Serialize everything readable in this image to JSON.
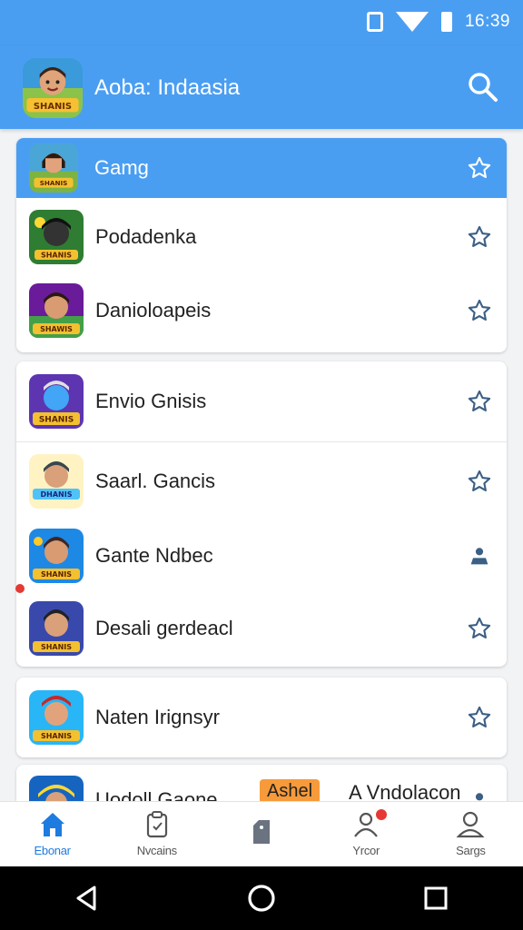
{
  "status_bar": {
    "time": "16:39",
    "icons": [
      "sim-icon",
      "wifi-icon",
      "battery-icon"
    ]
  },
  "app_bar": {
    "logo_text": "SHANIS",
    "title": "Aoba: Indaasia",
    "search_icon": "search-icon"
  },
  "colors": {
    "primary": "#4a9ef2",
    "active_nav": "#1e7be0",
    "accent_orange": "#f79a3a",
    "badge_red": "#e53935"
  },
  "cards": [
    {
      "items": [
        {
          "label": "Gamg",
          "selected": true,
          "thumb_text": "SHANIS"
        },
        {
          "label": "Podadenka",
          "selected": false,
          "thumb_text": "SHANIS"
        },
        {
          "label": "Danioloapeis",
          "selected": false,
          "thumb_text": "SHAWIS"
        }
      ]
    },
    {
      "items": [
        {
          "label": "Envio Gnisis",
          "selected": false,
          "thumb_text": "SHANIS"
        },
        {
          "label": "Saarl. Gancis",
          "selected": false,
          "thumb_text": "DHANIS"
        },
        {
          "label": "Gante Ndbec",
          "selected": false,
          "thumb_text": "SHANIS"
        },
        {
          "label": "Desali gerdeacl",
          "selected": false,
          "thumb_text": "SHANIS"
        }
      ]
    },
    {
      "items": [
        {
          "label": "Naten Irignsyr",
          "selected": false,
          "thumb_text": "SHANIS"
        }
      ]
    },
    {
      "items": [
        {
          "label": "Uodoll Gaone",
          "tag": "Ashel",
          "extra": "A Vndolacon",
          "selected": false
        }
      ]
    }
  ],
  "bottom_nav": [
    {
      "label": "Ebonar",
      "icon": "home-icon",
      "active": true
    },
    {
      "label": "Nvcains",
      "icon": "clipboard-icon",
      "active": false
    },
    {
      "label": "",
      "icon": "tag-icon",
      "active": false
    },
    {
      "label": "Yrcor",
      "icon": "notification-icon",
      "active": false,
      "badge": true
    },
    {
      "label": "Sargs",
      "icon": "profile-icon",
      "active": false
    }
  ],
  "system_nav": [
    "back-icon",
    "home-circle-icon",
    "recents-icon"
  ]
}
